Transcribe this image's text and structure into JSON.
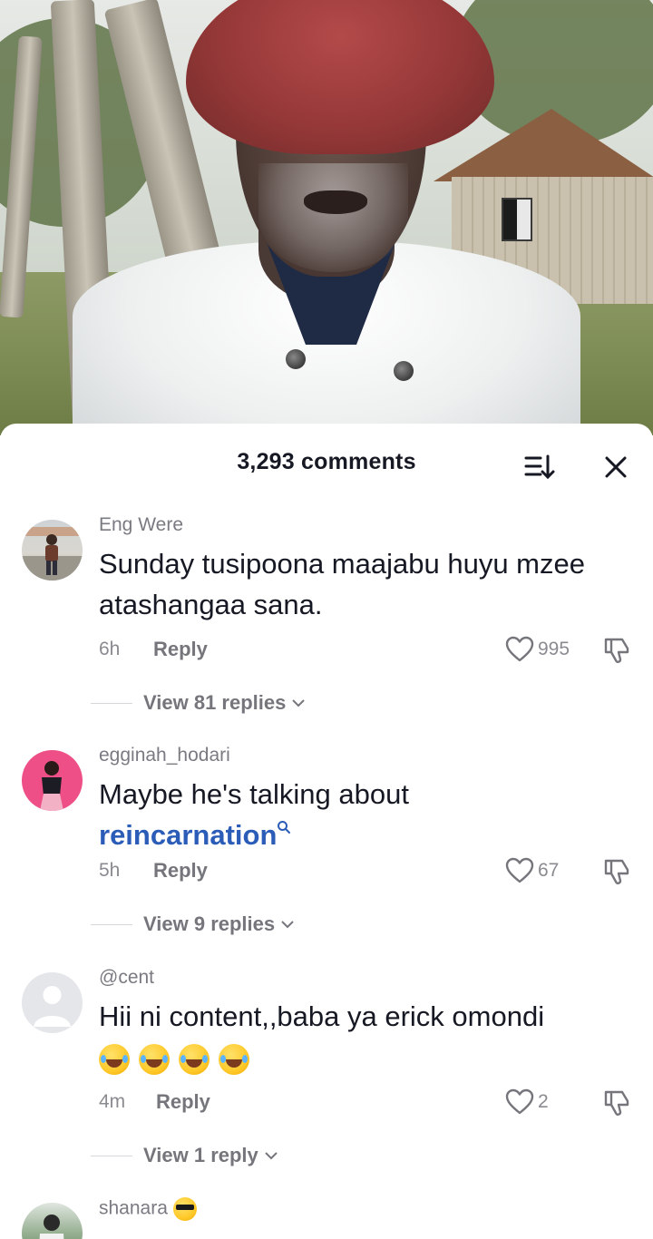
{
  "video": {
    "subject": "elderly man in red hat and white jacket"
  },
  "sheet": {
    "comment_count": "3,293 comments",
    "icons": {
      "sort": "sort-icon",
      "close": "close-icon"
    }
  },
  "comments": [
    {
      "username": "Eng Were",
      "text": "Sunday tusipoona maajabu huyu mzee atashangaa sana.",
      "time": "6h",
      "reply_label": "Reply",
      "likes": "995",
      "view_replies": "View 81 replies"
    },
    {
      "username": "egginah_hodari",
      "text": "Maybe he's talking about",
      "link": "reincarnation",
      "time": "5h",
      "reply_label": "Reply",
      "likes": "67",
      "view_replies": "View 9 replies"
    },
    {
      "username": "@cent",
      "text": "Hii ni content,,baba ya erick omondi",
      "emoji_count": 4,
      "time": "4m",
      "reply_label": "Reply",
      "likes": "2",
      "view_replies": "View 1 reply"
    },
    {
      "username": "shanara"
    }
  ],
  "colors": {
    "link": "#2b5db8",
    "text": "#161823",
    "muted": "#8a8b91"
  }
}
